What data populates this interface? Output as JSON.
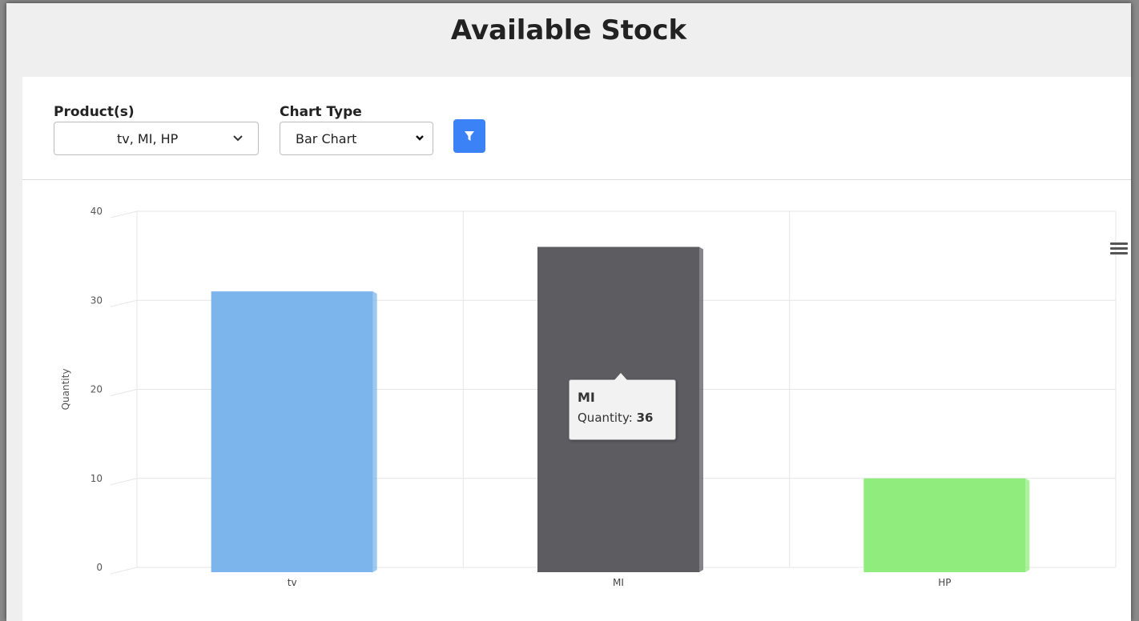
{
  "page": {
    "title": "Available Stock"
  },
  "filters": {
    "products_label": "Product(s)",
    "products_value": "tv, MI, HP",
    "chart_type_label": "Chart Type",
    "chart_type_value": "Bar Chart"
  },
  "icons": {
    "filter": "filter-icon",
    "chevron": "chevron-down-icon",
    "menu": "hamburger-menu-icon"
  },
  "colors": {
    "tv": "#7cb5ec",
    "MI": "#5c5c61",
    "HP": "#90ed7d",
    "filter_button": "#3b82f6"
  },
  "tooltip": {
    "title": "MI",
    "label": "Quantity:",
    "value": "36"
  },
  "chart_data": {
    "type": "bar",
    "categories": [
      "tv",
      "MI",
      "HP"
    ],
    "values": [
      31,
      36,
      10
    ],
    "colors": [
      "#7cb5ec",
      "#5c5c61",
      "#90ed7d"
    ],
    "title": "",
    "xlabel": "",
    "ylabel": "Quantity",
    "ylim": [
      0,
      40
    ],
    "yticks": [
      0,
      10,
      20,
      30,
      40
    ],
    "grid": true
  }
}
